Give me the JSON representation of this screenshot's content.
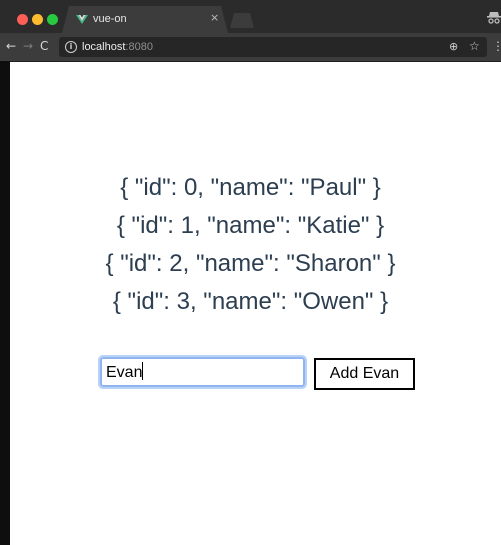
{
  "browser": {
    "tab_title": "vue-on",
    "tab_close_glyph": "×",
    "url_host": "localhost",
    "url_port": ":8080",
    "icons": {
      "favicon": "vue-favicon-icon",
      "back": "arrow-left-icon",
      "forward": "arrow-right-icon",
      "reload": "reload-icon",
      "info": "info-icon",
      "zoom": "zoom-icon",
      "bookmark": "star-icon",
      "menu": "kebab-menu-icon",
      "incognito": "incognito-icon"
    },
    "colors": {
      "close": "#fc5f57",
      "minimize": "#fdbc2e",
      "maximize": "#28c941"
    }
  },
  "users": [
    "{ \"id\": 0, \"name\": \"Paul\" }",
    "{ \"id\": 1, \"name\": \"Katie\" }",
    "{ \"id\": 2, \"name\": \"Sharon\" }",
    "{ \"id\": 3, \"name\": \"Owen\" }"
  ],
  "form": {
    "input_value": "Evan",
    "button_label": "Add Evan"
  },
  "text_color": "#2c3e50"
}
